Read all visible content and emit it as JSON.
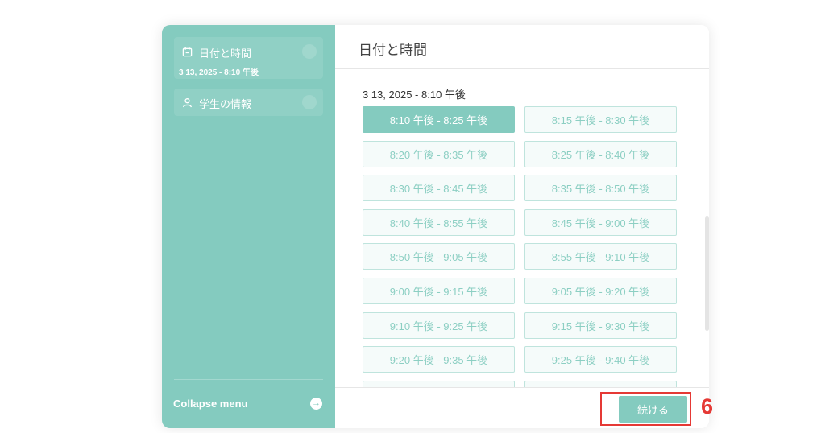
{
  "sidebar": {
    "items": [
      {
        "label": "日付と時間",
        "sub": "3 13, 2025 - 8:10 午後",
        "icon": "calendar-icon"
      },
      {
        "label": "学生の情報",
        "icon": "person-icon"
      }
    ],
    "collapse_label": "Collapse menu",
    "collapse_icon": "→"
  },
  "main": {
    "title": "日付と時間",
    "date_label": "3 13, 2025 - 8:10 午後",
    "selected_slot": "8:10 午後 - 8:25 午後",
    "slots": [
      "8:10 午後 - 8:25 午後",
      "8:15 午後 - 8:30 午後",
      "8:20 午後 - 8:35 午後",
      "8:25 午後 - 8:40 午後",
      "8:30 午後 - 8:45 午後",
      "8:35 午後 - 8:50 午後",
      "8:40 午後 - 8:55 午後",
      "8:45 午後 - 9:00 午後",
      "8:50 午後 - 9:05 午後",
      "8:55 午後 - 9:10 午後",
      "9:00 午後 - 9:15 午後",
      "9:05 午後 - 9:20 午後",
      "9:10 午後 - 9:25 午後",
      "9:15 午後 - 9:30 午後",
      "9:20 午後 - 9:35 午後",
      "9:25 午後 - 9:40 午後",
      "",
      ""
    ]
  },
  "footer": {
    "continue_label": "続ける"
  },
  "annotation": {
    "step": "6"
  },
  "colors": {
    "accent": "#84cbbf",
    "highlight": "#e53935"
  }
}
